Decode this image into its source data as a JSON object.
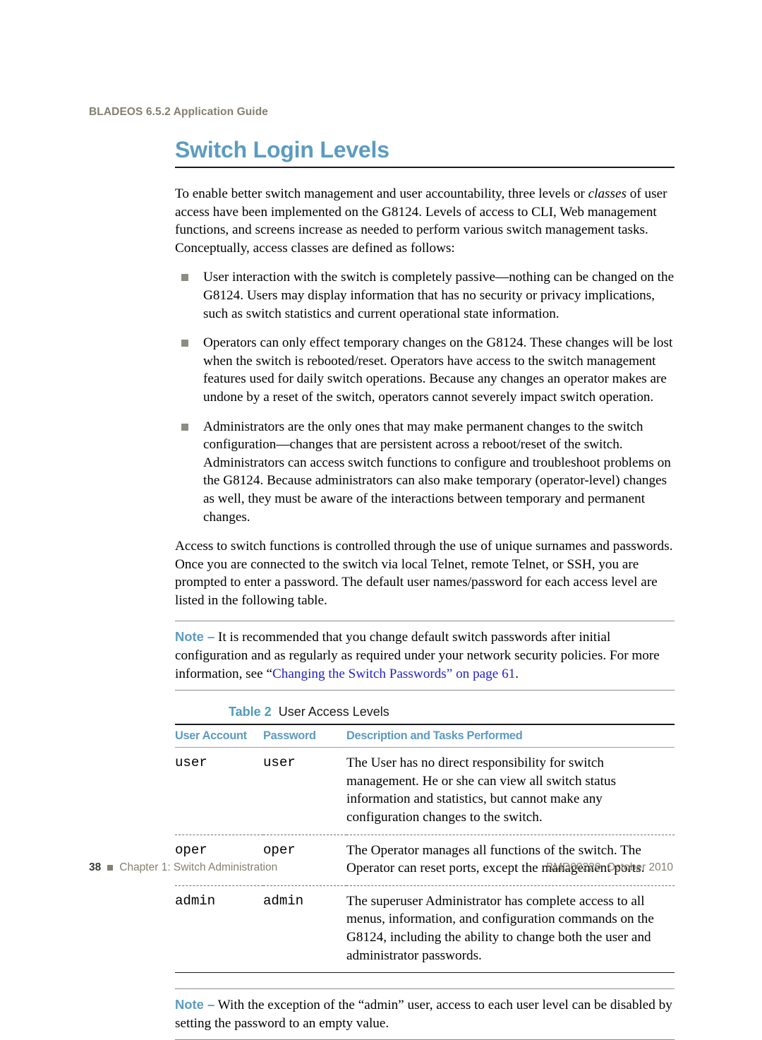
{
  "header": {
    "running_title": "BLADEOS 6.5.2 Application Guide"
  },
  "page_title": "Switch Login Levels",
  "intro_paragraph": "To enable better switch management and user accountability, three levels or classes of user access have been implemented on the G8124. Levels of access to CLI, Web management functions, and screens increase as needed to perform various switch management tasks. Conceptually, access classes are defined as follows:",
  "intro_italic_word": "classes",
  "bullets": [
    "User interaction with the switch is completely passive—nothing can be changed on the G8124. Users may display information that has no security or privacy implications, such as switch statistics and current operational state information.",
    "Operators can only effect temporary changes on the G8124. These changes will be lost when the switch is rebooted/reset. Operators have access to the switch management features used for daily switch operations. Because any changes an operator makes are undone by a reset of the switch, operators cannot severely impact switch operation.",
    "Administrators are the only ones that may make permanent changes to the switch configuration—changes that are persistent across a reboot/reset of the switch. Administrators can access switch functions to configure and troubleshoot problems on the G8124. Because administrators can also make temporary (operator-level) changes as well, they must be aware of the interactions between temporary and permanent changes."
  ],
  "access_paragraph": "Access to switch functions is controlled through the use of unique surnames and passwords. Once you are connected to the switch via local Telnet, remote Telnet, or SSH, you are prompted to enter a password. The default user names/password for each access level are listed in the following table.",
  "note_one": {
    "label": "Note –",
    "text_before_link": " It is recommended that you change default switch passwords after initial configuration and as regularly as required under your network security policies. For more information, see “",
    "link_text": "Changing the Switch Passwords” on page 61",
    "text_after_link": "."
  },
  "table": {
    "caption_number": "Table 2",
    "caption_title": "User Access Levels",
    "columns": [
      "User Account",
      "Password",
      "Description and Tasks Performed"
    ],
    "rows": [
      {
        "account": "user",
        "password": "user",
        "description": "The User has no direct responsibility for switch management. He or she can view all switch status information and statistics, but cannot make any configuration changes to the switch."
      },
      {
        "account": "oper",
        "password": "oper",
        "description": "The Operator manages all functions of the switch. The Operator can reset ports, except the management ports."
      },
      {
        "account": "admin",
        "password": "admin",
        "description": "The superuser Administrator has complete access to all menus, information, and configuration commands on the G8124, including the ability to change both the user and administrator passwords."
      }
    ]
  },
  "note_two": {
    "label": "Note –",
    "text": " With the exception of the “admin” user, access to each user level can be disabled by setting the password to an empty value."
  },
  "footer": {
    "page_number": "38",
    "chapter": "Chapter 1: Switch Administration",
    "doc_id": "BMD00220, October 2010"
  },
  "colors": {
    "accent_teal": "#5b9cc0",
    "link_blue": "#2222cc",
    "header_olive": "#84806e",
    "bullet_gray": "#8c8c82"
  }
}
